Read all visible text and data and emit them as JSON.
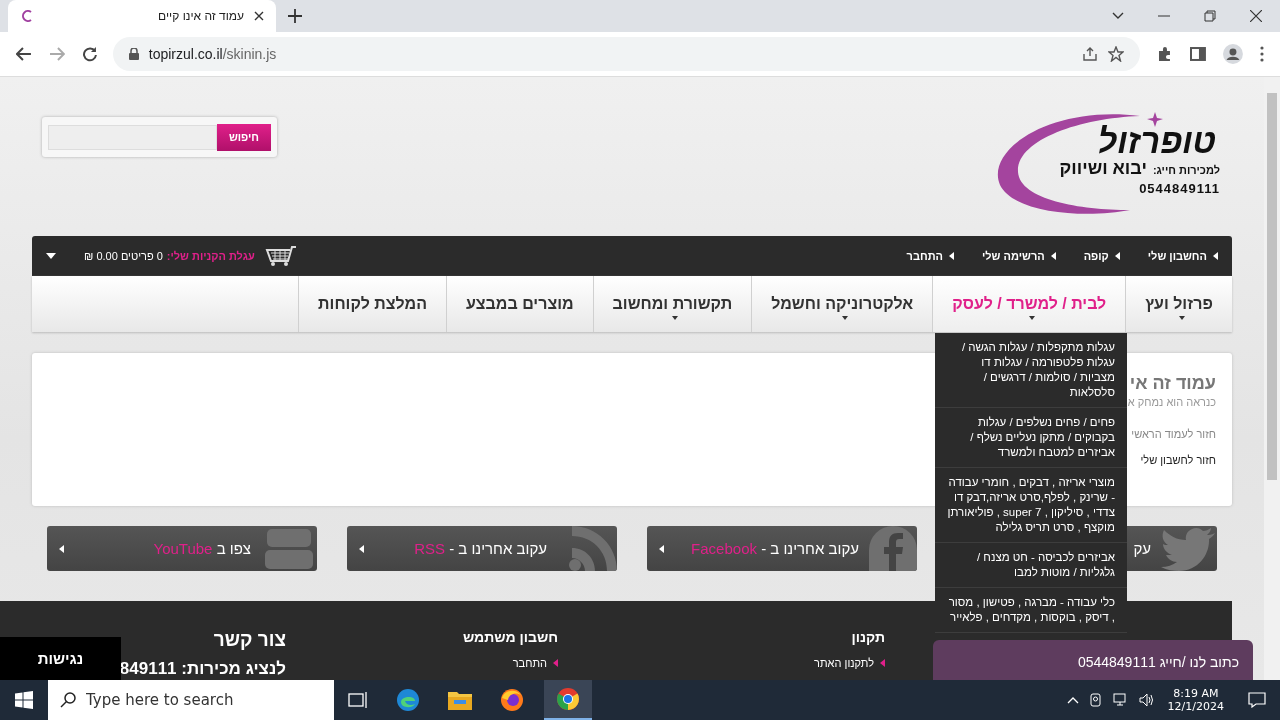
{
  "browser": {
    "tab_title": "עמוד זה אינו קיים",
    "url_host": "topirzul.co.il",
    "url_path": "/skinin.js"
  },
  "header": {
    "brand": "טופרזול",
    "tagline": "יבוא ושיווק",
    "sales_label": "למכירות חייג:",
    "phone": "0544849111",
    "search_button": "חיפוש"
  },
  "top_links": [
    "החשבון שלי",
    "קופה",
    "הרשימה שלי",
    "התחבר"
  ],
  "cart": {
    "label": "עגלת הקניות שלי:",
    "summary": "0 פריטים 0.00 ₪"
  },
  "nav": [
    {
      "label": "פרזול ועץ",
      "selected": false,
      "has_dropdown": true
    },
    {
      "label": "לבית / למשרד / לעסק",
      "selected": true,
      "has_dropdown": true
    },
    {
      "label": "אלקטרוניקה וחשמל",
      "selected": false,
      "has_dropdown": true
    },
    {
      "label": "תקשורת ומחשוב",
      "selected": false,
      "has_dropdown": true
    },
    {
      "label": "מוצרים במבצע",
      "selected": false,
      "has_dropdown": false
    },
    {
      "label": "המלצת לקוחות",
      "selected": false,
      "has_dropdown": false
    }
  ],
  "dropdown": [
    "עגלות מתקפלות / עגלות הגשה / עגלות פלטפורמה / עגלות דו מצביות / סולמות / דרגשים / סלסלאות",
    "פחים / פחים נשלפים / עגלות בקבוקים / מתקן נעליים נשלף / אביזרים למטבח ולמשרד",
    "מוצרי אריזה , דבקים , חומרי עבודה - שרינק , לפלף,סרט אריזה,דבק דו צדדי , סיליקון , super 7 , פוליאורתן מוקצף , סרט תריס גלילה",
    "אביזרים לכביסה - חט מצנח / גלגליות / מוטות למבו",
    "כלי עבודה - מברגה , פטישון , מסור , דיסק , בוקסות , מקדחים , פלאייר"
  ],
  "content": {
    "title": "עמוד זה אי",
    "subtitle": "כנראה הוא נמחק א",
    "links": [
      {
        "label": "חזור לעמוד הראשי",
        "kind": "muted"
      },
      {
        "label": "חזור לחשבון שלי",
        "kind": "strong"
      }
    ]
  },
  "social": [
    {
      "kind": "twitter",
      "text": "עק"
    },
    {
      "kind": "facebook",
      "text": "עקוב אחרינו ב - ",
      "brand": "Facebook"
    },
    {
      "kind": "rss",
      "text": "עקוב אחרינו ב - ",
      "brand": "RSS"
    },
    {
      "kind": "youtube",
      "text": "צפו ב ",
      "brand": "YouTube"
    }
  ],
  "footer": [
    {
      "title": "תקנון",
      "links": [
        "לתקנון האתר"
      ]
    },
    {
      "title": "חשבון משתמש",
      "links": [
        "התחבר"
      ]
    },
    {
      "title": "צור קשר",
      "text": "לנציג מכירות: 849111"
    }
  ],
  "accessibility_button": "נגישות",
  "chat_widget": "כתוב לנו /חייג 0544849111",
  "taskbar": {
    "search_placeholder": "Type here to search",
    "time": "8:19 AM",
    "date": "12/1/2024"
  }
}
